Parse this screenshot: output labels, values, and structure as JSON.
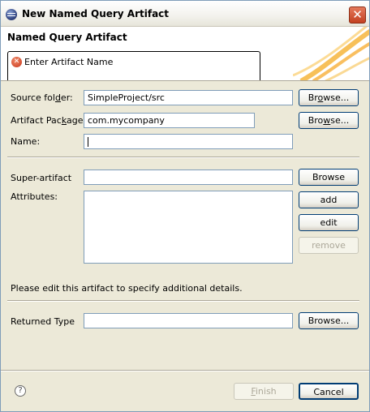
{
  "window": {
    "title": "New Named Query Artifact",
    "close_glyph": "✕"
  },
  "banner": {
    "title": "Named Query Artifact",
    "message": "Enter Artifact Name",
    "message_icon": "error-icon"
  },
  "form": {
    "source_folder_label_pre": "Source fol",
    "source_folder_label_u": "d",
    "source_folder_label_post": "er:",
    "source_folder_value": "SimpleProject/src",
    "artifact_package_label_pre": "Artifact Pac",
    "artifact_package_label_u": "k",
    "artifact_package_label_post": "age:",
    "artifact_package_value": "com.mycompany",
    "name_label": "Name:",
    "name_value": "",
    "browse_pre": "Br",
    "browse_u": "o",
    "browse_post": "wse...",
    "browse2_pre": "Bro",
    "browse2_u": "w",
    "browse2_post": "se...",
    "super_artifact_label": "Super-artifact",
    "super_artifact_value": "",
    "super_browse": "Browse",
    "attributes_label": "Attributes:",
    "add_button": "add",
    "edit_button": "edit",
    "remove_button": "remove",
    "info_text": "Please edit this artifact to specify additional details.",
    "returned_type_label": "Returned Type",
    "returned_type_value": "",
    "returned_browse": "Browse..."
  },
  "footer": {
    "help_glyph": "?",
    "finish_u": "F",
    "finish_rest": "inish",
    "cancel_button": "Cancel"
  }
}
